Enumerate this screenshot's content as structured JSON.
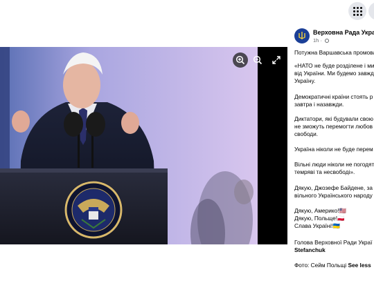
{
  "page": {
    "name": "Верховна Рада України",
    "time": "1h",
    "time_separator": "·"
  },
  "post": {
    "lines": [
      "Потужна Варшавська промова",
      "«НАТО не буде розділене і ми",
      "від України. Ми будемо завжд",
      "Україну.",
      "Демократичні країни стоять р",
      "завтра і назавжди.",
      "Диктатори, які будували свою",
      "не зможуть перемогти любов",
      "свободи.",
      "Україна ніколи не буде перем",
      "Вільні люди ніколи не погодят",
      "темряві та несвободі».",
      "Дякую, Джозефе Байдене, за г",
      "вільного Українського народу",
      "Дякую, Америко!🇺🇸",
      "Дякую, Польще!🇵🇱",
      "Слава Україні!🇺🇦",
      "Голова Верховної Ради Украї",
      "Stefanchuk"
    ],
    "photo_credit": "Фото: Сейм Польщі",
    "see_less": "See less"
  },
  "icons": [
    "menu-grid-icon",
    "messenger-icon",
    "zoom-in-icon",
    "zoom-out-icon",
    "fullscreen-icon",
    "globe-icon"
  ],
  "colors": {
    "accent": "#1b3f97",
    "muted": "#65676b",
    "photo_bg": "#000000"
  }
}
